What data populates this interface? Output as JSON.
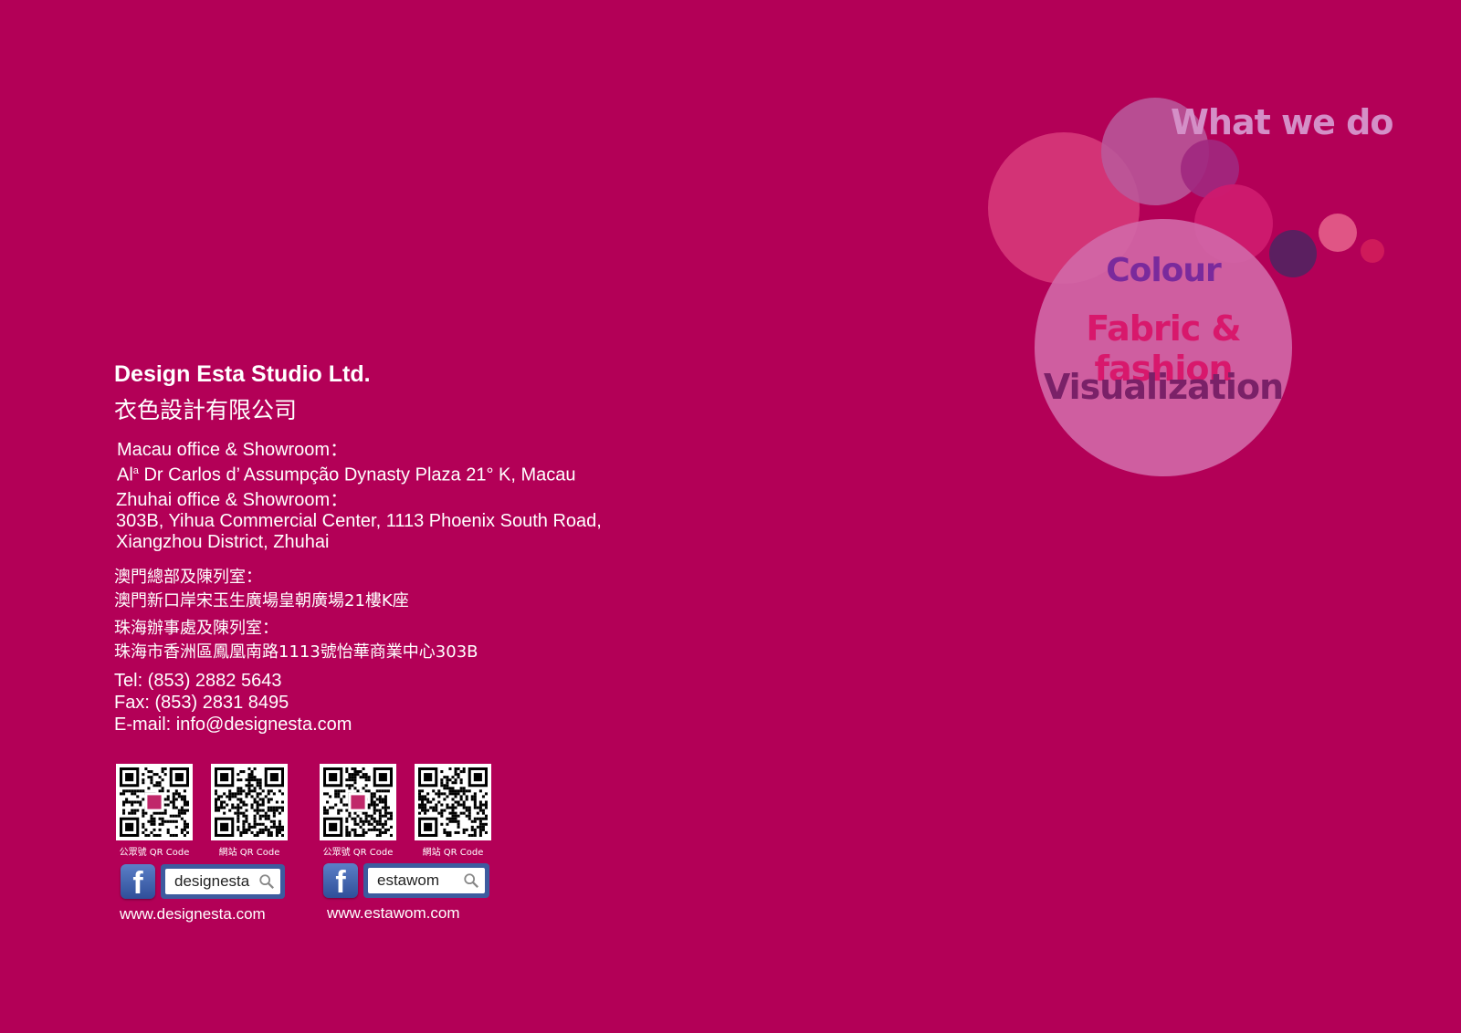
{
  "bubbles": {
    "what": "What we do",
    "items": [
      "Colour",
      "Fabric & fashion",
      "Visualization"
    ]
  },
  "company": {
    "name_en": "Design Esta Studio Ltd.",
    "name_zh": "衣色設計有限公司"
  },
  "addresses": {
    "macau_label": "Macau office & Showroom：",
    "macau_prefix": "Al",
    "macau_sup": "a",
    "macau_rest": " Dr Carlos d’ Assumpção Dynasty Plaza 21° K, Macau",
    "zhuhai_label": "Zhuhai office & Showroom：",
    "zhuhai_line1": "303B, Yihua Commercial Center, 1113 Phoenix South Road,",
    "zhuhai_line2": "Xiangzhou District, Zhuhai",
    "macau_zh_label": "澳門總部及陳列室：",
    "macau_zh": "澳門新口岸宋玉生廣場皇朝廣場21樓K座",
    "zhuhai_zh_label": "珠海辦事處及陳列室：",
    "zhuhai_zh": "珠海市香洲區鳳凰南路1113號怡華商業中心303B"
  },
  "contact": {
    "tel": "Tel: (853) 2882 5643",
    "fax": "Fax: (853) 2831 8495",
    "email": "E-mail: info@designesta.com"
  },
  "social": [
    {
      "qr1_label": "公眾號 QR Code",
      "qr2_label": "網站 QR Code",
      "fb_search": "designesta",
      "url": "www.designesta.com"
    },
    {
      "qr1_label": "公眾號 QR Code",
      "qr2_label": "網站 QR Code",
      "fb_search": "estawom",
      "url": "www.estawom.com"
    }
  ],
  "colors": {
    "background": "#b30057",
    "facebook": "#3d5b9f"
  }
}
